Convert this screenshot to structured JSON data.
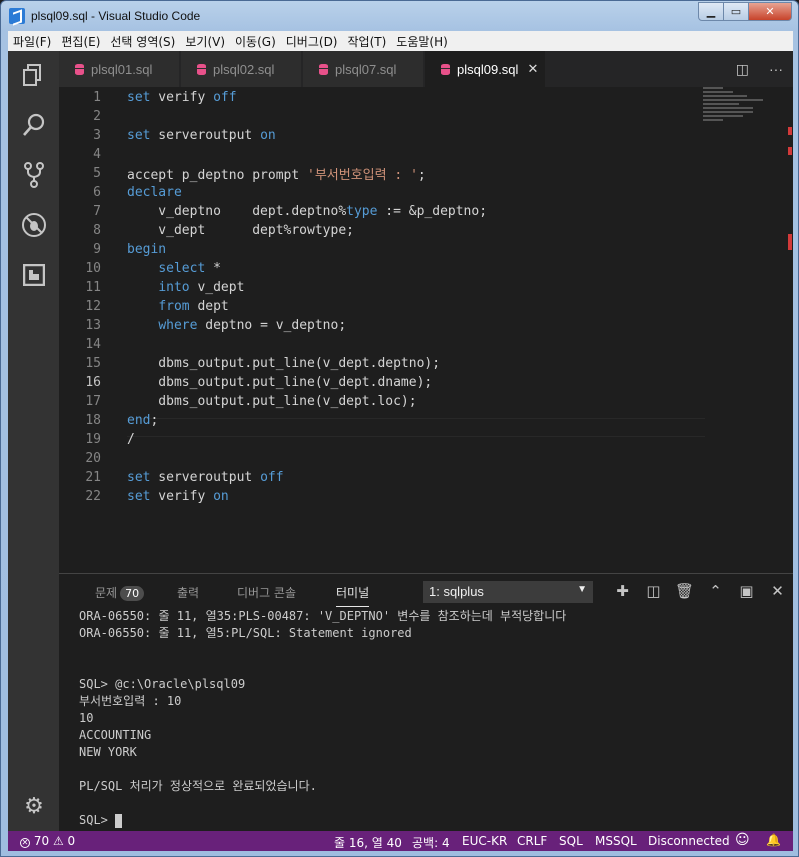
{
  "window": {
    "title": "plsql09.sql - Visual Studio Code"
  },
  "menu": [
    "파일(F)",
    "편집(E)",
    "선택 영역(S)",
    "보기(V)",
    "이동(G)",
    "디버그(D)",
    "작업(T)",
    "도움말(H)"
  ],
  "tabs": [
    {
      "label": "plsql01.sql"
    },
    {
      "label": "plsql02.sql"
    },
    {
      "label": "plsql07.sql"
    },
    {
      "label": "plsql09.sql",
      "close": "✕"
    }
  ],
  "editor": {
    "lines": [
      {
        "n": "1",
        "kw1": "set",
        "t1": " verify ",
        "kw2": "off",
        "t2": ""
      },
      {
        "n": "2",
        "kw1": "",
        "t1": "",
        "kw2": "",
        "t2": ""
      },
      {
        "n": "3",
        "kw1": "set",
        "t1": " serveroutput ",
        "kw2": "on",
        "t2": ""
      },
      {
        "n": "4",
        "kw1": "",
        "t1": "",
        "kw2": "",
        "t2": ""
      },
      {
        "n": "5",
        "kw1": "",
        "t1": "accept p_deptno prompt ",
        "kw2": "",
        "str": "'부서번호입력 : '",
        "t2": ";"
      },
      {
        "n": "6",
        "kw1": "declare",
        "t1": "",
        "kw2": "",
        "t2": ""
      },
      {
        "n": "7",
        "kw1": "",
        "t1": "    v_deptno    dept.deptno%",
        "kw2": "type",
        "t2": " := &p_deptno;"
      },
      {
        "n": "8",
        "kw1": "",
        "t1": "    v_dept      dept%rowtype;",
        "kw2": "",
        "t2": ""
      },
      {
        "n": "9",
        "kw1": "begin",
        "t1": "",
        "kw2": "",
        "t2": ""
      },
      {
        "n": "10",
        "kw1": "",
        "t1": "    ",
        "kw2": "select",
        "t2": " *"
      },
      {
        "n": "11",
        "kw1": "",
        "t1": "    ",
        "kw2": "into",
        "t2": " v_dept"
      },
      {
        "n": "12",
        "kw1": "",
        "t1": "    ",
        "kw2": "from",
        "t2": " dept"
      },
      {
        "n": "13",
        "kw1": "",
        "t1": "    ",
        "kw2": "where",
        "t2": " deptno = v_deptno;"
      },
      {
        "n": "14",
        "kw1": "",
        "t1": "",
        "kw2": "",
        "t2": ""
      },
      {
        "n": "15",
        "kw1": "",
        "t1": "    dbms_output.put_line(v_dept.deptno);",
        "kw2": "",
        "t2": ""
      },
      {
        "n": "16",
        "kw1": "",
        "t1": "    dbms_output.put_line(v_dept.dname);",
        "kw2": "",
        "t2": ""
      },
      {
        "n": "17",
        "kw1": "",
        "t1": "    dbms_output.put_line(v_dept.loc);",
        "kw2": "",
        "t2": ""
      },
      {
        "n": "18",
        "kw1": "end",
        "t1": ";",
        "kw2": "",
        "t2": ""
      },
      {
        "n": "19",
        "kw1": "",
        "t1": "/",
        "kw2": "",
        "t2": ""
      },
      {
        "n": "20",
        "kw1": "",
        "t1": "",
        "kw2": "",
        "t2": ""
      },
      {
        "n": "21",
        "kw1": "set",
        "t1": " serveroutput ",
        "kw2": "off",
        "t2": ""
      },
      {
        "n": "22",
        "kw1": "set",
        "t1": " verify ",
        "kw2": "on",
        "t2": ""
      }
    ]
  },
  "panel": {
    "tabs": [
      "문제",
      "출력",
      "디버그 콘솔",
      "터미널"
    ],
    "problems_count": "70",
    "terminal_select": "1: sqlplus",
    "terminal_lines": [
      "ORA-06550: 줄 11, 열35:PLS-00487: 'V_DEPTNO' 변수를 참조하는데 부적당합니다",
      "ORA-06550: 줄 11, 열5:PL/SQL: Statement ignored",
      "",
      "",
      "SQL> @c:\\Oracle\\plsql09",
      "부서번호입력 : 10",
      "10",
      "ACCOUNTING",
      "NEW YORK",
      "",
      "PL/SQL 처리가 정상적으로 완료되었습니다.",
      "",
      "SQL> "
    ]
  },
  "status": {
    "errors": "70",
    "warnings": "0",
    "position": "줄 16, 열 40",
    "spaces": "공백: 4",
    "encoding": "EUC-KR",
    "eol": "CRLF",
    "language": "SQL",
    "dialect": "MSSQL",
    "connection": "Disconnected"
  },
  "colors": {
    "statusbar": "#68217a",
    "keyword": "#569cd6",
    "string": "#ce9178",
    "tab_icon": "#e8518a"
  }
}
